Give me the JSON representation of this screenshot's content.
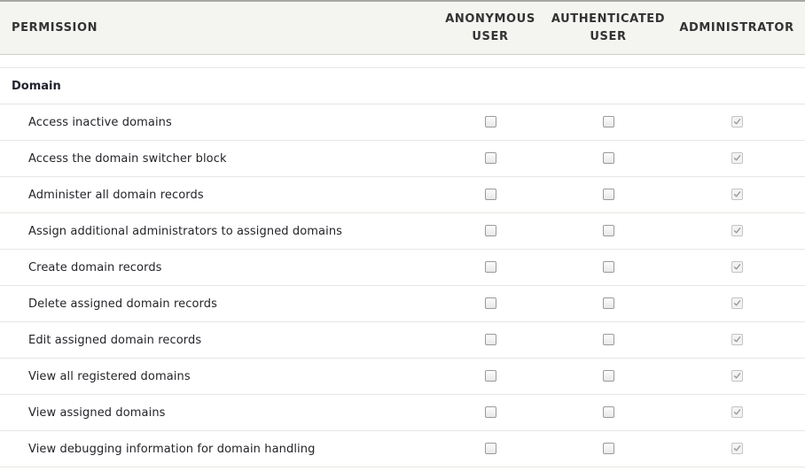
{
  "header": {
    "permission": "PERMISSION",
    "roles": [
      {
        "line1": "ANONYMOUS",
        "line2": "USER"
      },
      {
        "line1": "AUTHENTICATED",
        "line2": "USER"
      },
      {
        "line1": "ADMINISTRATOR",
        "line2": ""
      }
    ]
  },
  "module": {
    "name": "Domain"
  },
  "permissions": [
    {
      "label": "Access inactive domains",
      "anonymous": false,
      "authenticated": false,
      "administrator": true
    },
    {
      "label": "Access the domain switcher block",
      "anonymous": false,
      "authenticated": false,
      "administrator": true
    },
    {
      "label": "Administer all domain records",
      "anonymous": false,
      "authenticated": false,
      "administrator": true
    },
    {
      "label": "Assign additional administrators to assigned domains",
      "anonymous": false,
      "authenticated": false,
      "administrator": true
    },
    {
      "label": "Create domain records",
      "anonymous": false,
      "authenticated": false,
      "administrator": true
    },
    {
      "label": "Delete assigned domain records",
      "anonymous": false,
      "authenticated": false,
      "administrator": true
    },
    {
      "label": "Edit assigned domain records",
      "anonymous": false,
      "authenticated": false,
      "administrator": true
    },
    {
      "label": "View all registered domains",
      "anonymous": false,
      "authenticated": false,
      "administrator": true
    },
    {
      "label": "View assigned domains",
      "anonymous": false,
      "authenticated": false,
      "administrator": true
    },
    {
      "label": "View debugging information for domain handling",
      "anonymous": false,
      "authenticated": false,
      "administrator": true
    }
  ]
}
